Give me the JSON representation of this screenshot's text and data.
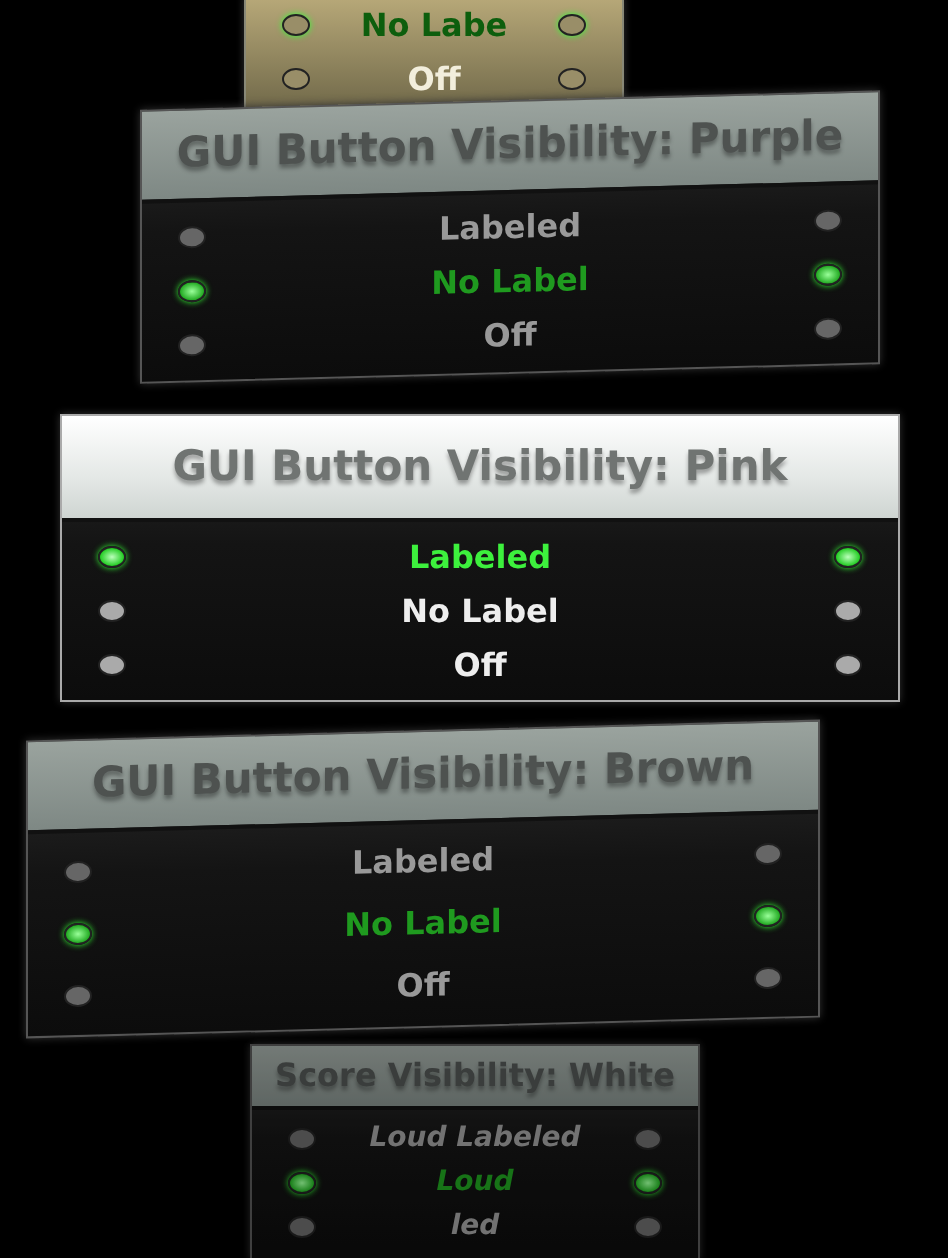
{
  "panels": [
    {
      "selected": false,
      "options": [
        {
          "label": "No Labe",
          "selected": true
        },
        {
          "label": "Off",
          "selected": false
        }
      ]
    },
    {
      "title": "GUI Button Visibility: Purple",
      "selected": false,
      "options": [
        {
          "label": "Labeled",
          "selected": false
        },
        {
          "label": "No Label",
          "selected": true
        },
        {
          "label": "Off",
          "selected": false
        }
      ]
    },
    {
      "title": "GUI Button Visibility: Pink",
      "selected": true,
      "options": [
        {
          "label": "Labeled",
          "selected": true
        },
        {
          "label": "No Label",
          "selected": false
        },
        {
          "label": "Off",
          "selected": false
        }
      ]
    },
    {
      "title": "GUI Button Visibility: Brown",
      "selected": false,
      "options": [
        {
          "label": "Labeled",
          "selected": false
        },
        {
          "label": "No Label",
          "selected": true
        },
        {
          "label": "Off",
          "selected": false
        }
      ]
    },
    {
      "title": "Score Visibility: White",
      "selected": false,
      "options": [
        {
          "label": "Loud Labeled",
          "selected": false
        },
        {
          "label": "Loud",
          "selected": true
        },
        {
          "label": "led",
          "selected": false
        }
      ]
    }
  ]
}
